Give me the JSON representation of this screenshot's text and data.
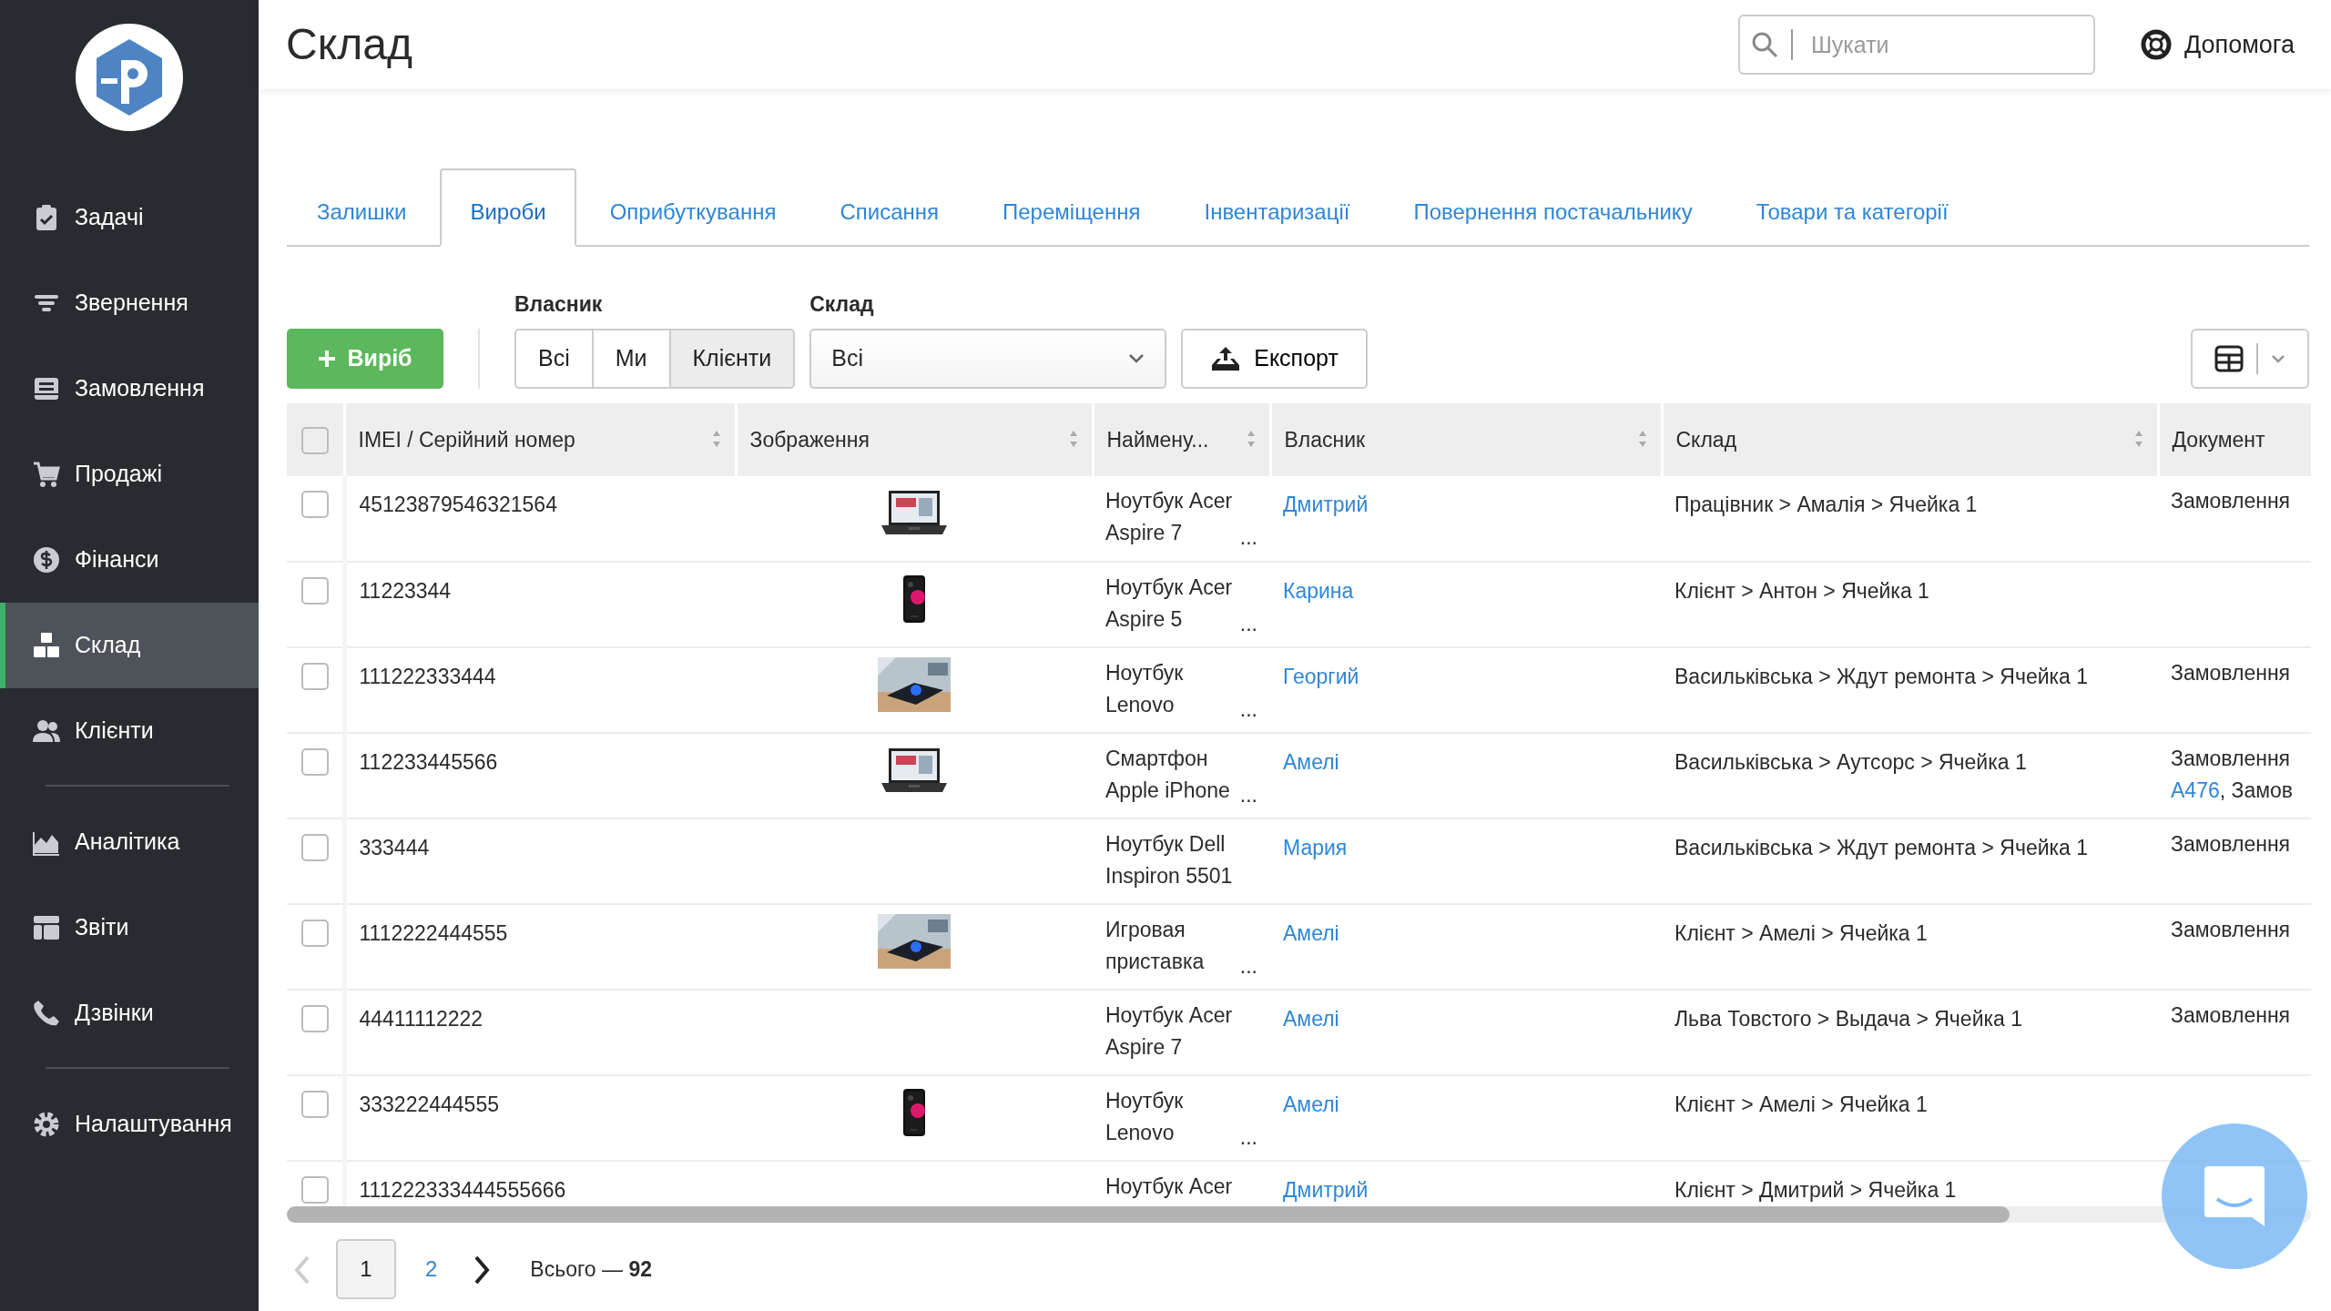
{
  "sidebar": {
    "sections": [
      {
        "items": [
          {
            "label": "Задачі",
            "selected": false
          },
          {
            "label": "Звернення",
            "selected": false
          },
          {
            "label": "Замовлення",
            "selected": false
          },
          {
            "label": "Продажі",
            "selected": false
          },
          {
            "label": "Фінанси",
            "selected": false
          },
          {
            "label": "Склад",
            "selected": true
          },
          {
            "label": "Клієнти",
            "selected": false
          }
        ]
      },
      {
        "items": [
          {
            "label": "Аналітика",
            "selected": false
          },
          {
            "label": "Звіти",
            "selected": false
          },
          {
            "label": "Дзвінки",
            "selected": false
          }
        ]
      },
      {
        "items": [
          {
            "label": "Налаштування",
            "selected": false
          }
        ]
      }
    ]
  },
  "header": {
    "title": "Склад",
    "search": {
      "placeholder": "Шукати"
    },
    "help": "Допомога"
  },
  "tabs": [
    {
      "label": "Залишки",
      "selected": false
    },
    {
      "label": "Вироби",
      "selected": true
    },
    {
      "label": "Оприбуткування",
      "selected": false
    },
    {
      "label": "Списання",
      "selected": false
    },
    {
      "label": "Переміщення",
      "selected": false
    },
    {
      "label": "Інвентаризації",
      "selected": false
    },
    {
      "label": "Повернення постачальнику",
      "selected": false
    },
    {
      "label": "Товари та категорії",
      "selected": false
    }
  ],
  "toolbar": {
    "add_button": "Виріб",
    "owner": {
      "label": "Власник",
      "options": [
        {
          "label": "Всі",
          "selected": false
        },
        {
          "label": "Ми",
          "selected": false
        },
        {
          "label": "Клієнти",
          "selected": true
        }
      ]
    },
    "warehouse": {
      "label": "Склад",
      "value": "Всі"
    },
    "export_button": "Експорт"
  },
  "table": {
    "header_checked": false,
    "columns": [
      {
        "label": "IMEI / Серійний номер",
        "sortable": true
      },
      {
        "label": "Зображення",
        "sortable": true
      },
      {
        "label": "Наймену...",
        "sortable": true
      },
      {
        "label": "Власник",
        "sortable": true
      },
      {
        "label": "Склад",
        "sortable": true
      },
      {
        "label": "Документ",
        "sortable": false
      }
    ],
    "rows": [
      {
        "checked": false,
        "imei": "45123879546321564",
        "has_image": true,
        "name": "Ноутбук Acer Aspire 7",
        "ellipsis": "...",
        "owner": "Дмитрий",
        "warehouse": "Працівник > Амалія > Ячейка 1",
        "document": "Замовлення"
      },
      {
        "checked": false,
        "imei": "11223344",
        "has_image": true,
        "name": "Ноутбук Acer Aspire 5",
        "ellipsis": "...",
        "owner": "Карина",
        "warehouse": "Клієнт > Антон > Ячейка 1"
      },
      {
        "checked": false,
        "imei": "111222333444",
        "has_image": true,
        "name": "Ноутбук Lenovo",
        "ellipsis": "...",
        "owner": "Георгий",
        "warehouse": "Васильківська > Ждут ремонта > Ячейка 1",
        "document": "Замовлення"
      },
      {
        "checked": false,
        "imei": "112233445566",
        "has_image": true,
        "name": "Смартфон Apple iPhone",
        "ellipsis": "...",
        "owner": "Амелі",
        "warehouse": "Васильківська > Аутсорс > Ячейка 1",
        "document": "Замовлення",
        "document_link": "A476",
        "document_tail": ", Замов"
      },
      {
        "checked": false,
        "imei": "333444",
        "has_image": false,
        "name": "Ноутбук Dell Inspiron 5501",
        "owner": "Мария",
        "warehouse": "Васильківська > Ждут ремонта > Ячейка 1",
        "document": "Замовлення"
      },
      {
        "checked": false,
        "imei": "1112222444555",
        "has_image": true,
        "name": "Игровая приставка",
        "ellipsis": "...",
        "owner": "Амелі",
        "warehouse": "Клієнт > Амелі > Ячейка 1",
        "document": "Замовлення"
      },
      {
        "checked": false,
        "imei": "44411112222",
        "has_image": false,
        "name": "Ноутбук Acer Aspire 7",
        "owner": "Амелі",
        "warehouse": "Льва Товстого > Выдача > Ячейка 1",
        "document": "Замовлення"
      },
      {
        "checked": false,
        "imei": "333222444555",
        "has_image": true,
        "name": "Ноутбук Lenovo",
        "ellipsis": "...",
        "owner": "Амелі",
        "warehouse": "Клієнт > Амелі > Ячейка 1"
      },
      {
        "checked": false,
        "imei": "111222333444555666",
        "has_image": false,
        "name": "Ноутбук Acer",
        "owner": "Дмитрий",
        "warehouse": "Клієнт > Дмитрий > Ячейка 1"
      }
    ]
  },
  "pagination": {
    "prev": {
      "disabled": true
    },
    "next": {
      "disabled": false
    },
    "pages": [
      {
        "label": "1",
        "selected": true
      },
      {
        "label": "2",
        "selected": false
      }
    ],
    "total": "Всього — **92**"
  }
}
